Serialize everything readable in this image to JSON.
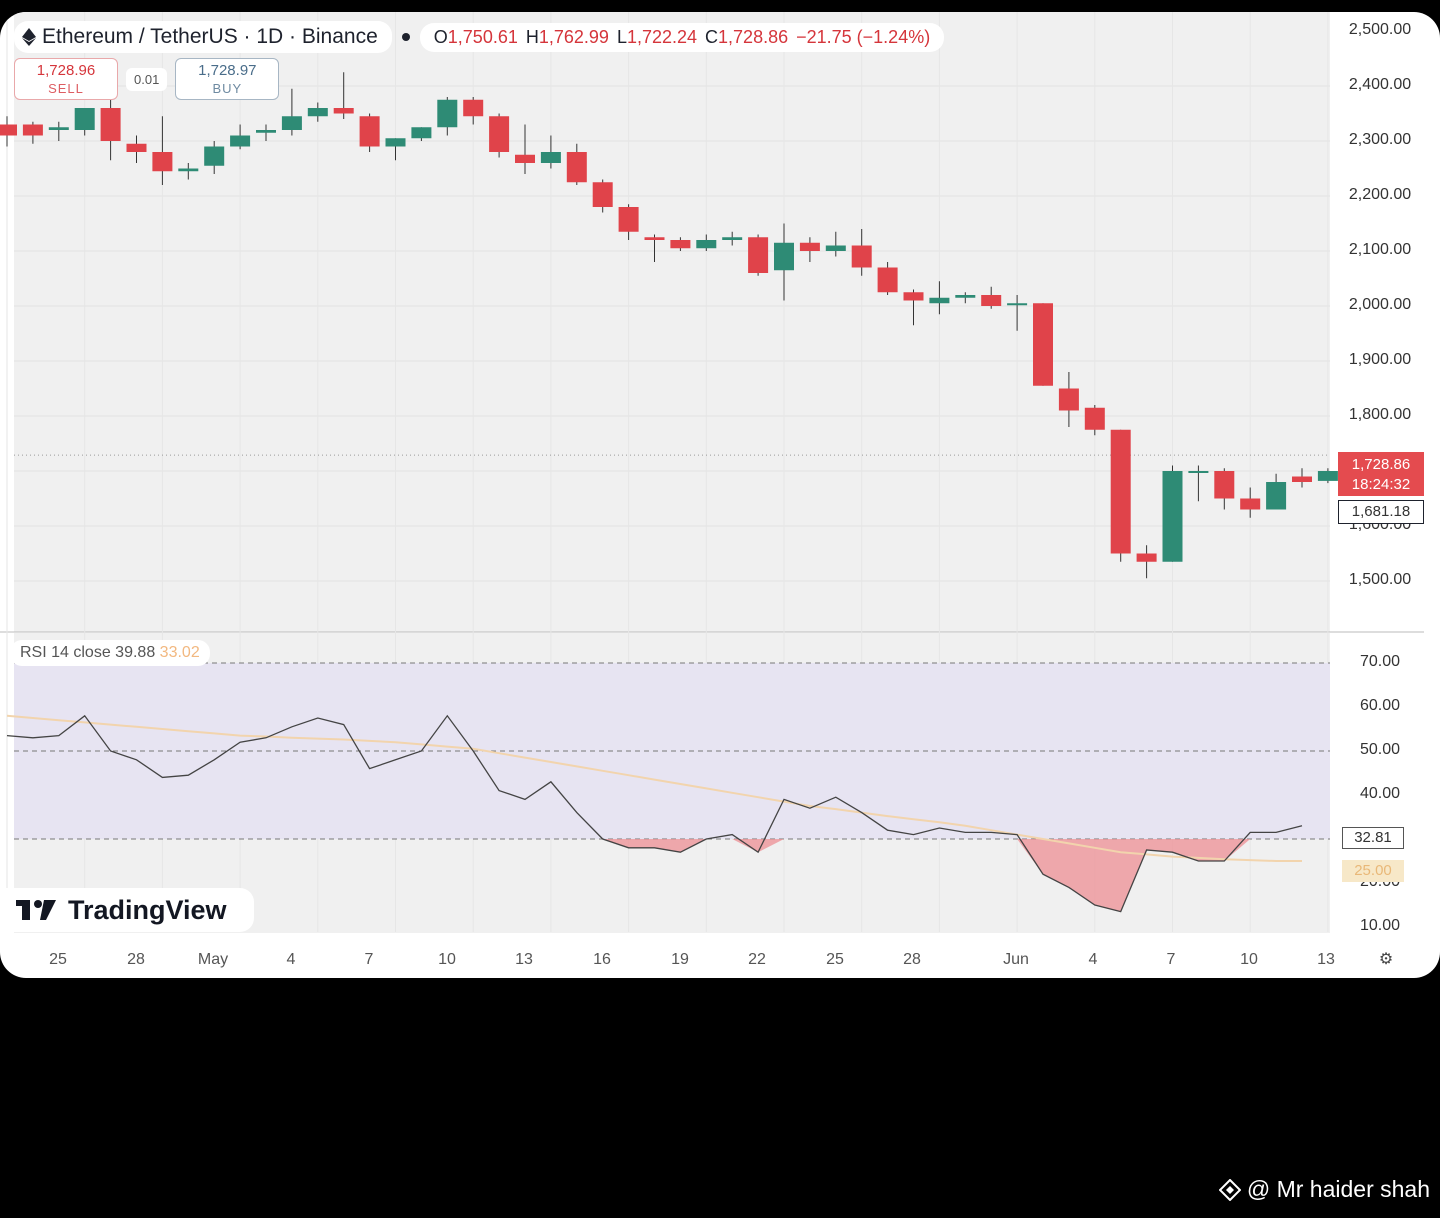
{
  "header": {
    "symbol_title": "Ethereum / TetherUS · 1D · Binance",
    "ohlc": {
      "o_label": "O",
      "o_value": "1,750.61",
      "h_label": "H",
      "h_value": "1,762.99",
      "l_label": "L",
      "l_value": "1,722.24",
      "c_label": "C",
      "c_value": "1,728.86",
      "change": "−21.75 (−1.24%)"
    }
  },
  "trade": {
    "sell_price": "1,728.96",
    "sell_label": "SELL",
    "spread": "0.01",
    "buy_price": "1,728.97",
    "buy_label": "BUY"
  },
  "price_scale": {
    "top_partial": "2,500.00",
    "labels": [
      "2,400.00",
      "2,300.00",
      "2,200.00",
      "2,100.00",
      "2,000.00",
      "1,900.00",
      "1,800.00",
      "1,600.00",
      "1,500.00"
    ],
    "current_price": "1,728.86",
    "countdown": "18:24:32",
    "ref_price": "1,681.18"
  },
  "rsi": {
    "legend_name": "RSI 14 close",
    "legend_value": "39.88",
    "legend_ma_value": "33.02",
    "scale": [
      "70.00",
      "60.00",
      "50.00",
      "40.00",
      "30.00",
      "20.00",
      "10.00"
    ],
    "current": "32.81",
    "ma_current": "25.00"
  },
  "time_axis": [
    "25",
    "28",
    "May",
    "4",
    "7",
    "10",
    "13",
    "16",
    "19",
    "22",
    "25",
    "28",
    "Jun",
    "4",
    "7",
    "10",
    "13"
  ],
  "branding": {
    "logo_text": "TradingView",
    "watermark": "@ Mr haider shah",
    "settings_glyph": "⚙"
  },
  "colors": {
    "up": "#2e8b75",
    "down": "#e0434a",
    "rsi_line": "#444444",
    "rsi_ma": "#f2d4ad",
    "rsi_band": "#e7e4f2",
    "oversold_fill": "#ee8f94"
  },
  "chart_data": {
    "type": "candlestick",
    "title": "Ethereum / TetherUS · 1D · Binance",
    "ylim": [
      1450,
      2500
    ],
    "candles": [
      {
        "o": 2330,
        "h": 2345,
        "l": 2290,
        "c": 2310
      },
      {
        "o": 2330,
        "h": 2335,
        "l": 2295,
        "c": 2310
      },
      {
        "o": 2320,
        "h": 2335,
        "l": 2300,
        "c": 2325
      },
      {
        "o": 2320,
        "h": 2360,
        "l": 2310,
        "c": 2360
      },
      {
        "o": 2360,
        "h": 2380,
        "l": 2265,
        "c": 2300
      },
      {
        "o": 2295,
        "h": 2310,
        "l": 2260,
        "c": 2280
      },
      {
        "o": 2280,
        "h": 2345,
        "l": 2220,
        "c": 2245
      },
      {
        "o": 2245,
        "h": 2260,
        "l": 2230,
        "c": 2250
      },
      {
        "o": 2255,
        "h": 2300,
        "l": 2240,
        "c": 2290
      },
      {
        "o": 2290,
        "h": 2330,
        "l": 2285,
        "c": 2310
      },
      {
        "o": 2315,
        "h": 2330,
        "l": 2300,
        "c": 2320
      },
      {
        "o": 2320,
        "h": 2395,
        "l": 2310,
        "c": 2345
      },
      {
        "o": 2345,
        "h": 2370,
        "l": 2335,
        "c": 2360
      },
      {
        "o": 2360,
        "h": 2425,
        "l": 2340,
        "c": 2350
      },
      {
        "o": 2345,
        "h": 2350,
        "l": 2280,
        "c": 2290
      },
      {
        "o": 2290,
        "h": 2305,
        "l": 2265,
        "c": 2305
      },
      {
        "o": 2305,
        "h": 2325,
        "l": 2300,
        "c": 2325
      },
      {
        "o": 2325,
        "h": 2380,
        "l": 2310,
        "c": 2375
      },
      {
        "o": 2375,
        "h": 2380,
        "l": 2330,
        "c": 2345
      },
      {
        "o": 2345,
        "h": 2350,
        "l": 2270,
        "c": 2280
      },
      {
        "o": 2275,
        "h": 2330,
        "l": 2240,
        "c": 2260
      },
      {
        "o": 2260,
        "h": 2310,
        "l": 2250,
        "c": 2280
      },
      {
        "o": 2280,
        "h": 2295,
        "l": 2220,
        "c": 2225
      },
      {
        "o": 2225,
        "h": 2230,
        "l": 2170,
        "c": 2180
      },
      {
        "o": 2180,
        "h": 2185,
        "l": 2120,
        "c": 2135
      },
      {
        "o": 2125,
        "h": 2130,
        "l": 2080,
        "c": 2120
      },
      {
        "o": 2120,
        "h": 2125,
        "l": 2100,
        "c": 2105
      },
      {
        "o": 2105,
        "h": 2130,
        "l": 2100,
        "c": 2120
      },
      {
        "o": 2120,
        "h": 2135,
        "l": 2110,
        "c": 2125
      },
      {
        "o": 2125,
        "h": 2130,
        "l": 2055,
        "c": 2060
      },
      {
        "o": 2065,
        "h": 2150,
        "l": 2010,
        "c": 2115
      },
      {
        "o": 2115,
        "h": 2125,
        "l": 2080,
        "c": 2100
      },
      {
        "o": 2100,
        "h": 2135,
        "l": 2090,
        "c": 2110
      },
      {
        "o": 2110,
        "h": 2140,
        "l": 2055,
        "c": 2070
      },
      {
        "o": 2070,
        "h": 2080,
        "l": 2020,
        "c": 2025
      },
      {
        "o": 2025,
        "h": 2030,
        "l": 1965,
        "c": 2010
      },
      {
        "o": 2005,
        "h": 2045,
        "l": 1985,
        "c": 2015
      },
      {
        "o": 2015,
        "h": 2025,
        "l": 2005,
        "c": 2020
      },
      {
        "o": 2020,
        "h": 2035,
        "l": 1995,
        "c": 2000
      },
      {
        "o": 2005,
        "h": 2020,
        "l": 1955,
        "c": 2005
      },
      {
        "o": 2005,
        "h": 2005,
        "l": 1855,
        "c": 1855
      },
      {
        "o": 1850,
        "h": 1880,
        "l": 1780,
        "c": 1810
      },
      {
        "o": 1815,
        "h": 1820,
        "l": 1765,
        "c": 1775
      },
      {
        "o": 1775,
        "h": 1775,
        "l": 1535,
        "c": 1550
      },
      {
        "o": 1550,
        "h": 1565,
        "l": 1505,
        "c": 1535
      },
      {
        "o": 1535,
        "h": 1710,
        "l": 1535,
        "c": 1700
      },
      {
        "o": 1700,
        "h": 1710,
        "l": 1645,
        "c": 1700
      },
      {
        "o": 1700,
        "h": 1705,
        "l": 1630,
        "c": 1650
      },
      {
        "o": 1650,
        "h": 1670,
        "l": 1615,
        "c": 1630
      },
      {
        "o": 1630,
        "h": 1695,
        "l": 1630,
        "c": 1680
      },
      {
        "o": 1690,
        "h": 1705,
        "l": 1670,
        "c": 1680
      },
      {
        "o": 1682,
        "h": 1705,
        "l": 1678,
        "c": 1700
      }
    ],
    "rsi": {
      "ylim": [
        0,
        80
      ],
      "series": [
        {
          "name": "RSI 14 close",
          "values": [
            53.5,
            53,
            53.5,
            58,
            50,
            48,
            44,
            44.5,
            48,
            52,
            53,
            55.5,
            57.5,
            56,
            46,
            48,
            50,
            58,
            50,
            41,
            39,
            43,
            36,
            30,
            28,
            28,
            27,
            30,
            31,
            27,
            39,
            37,
            39.5,
            36,
            32,
            31,
            32.5,
            31.5,
            31.5,
            31,
            22,
            19,
            15,
            13.5,
            27.5,
            27,
            25,
            25,
            31.5,
            31.5,
            33
          ]
        },
        {
          "name": "RSI MA",
          "values": [
            58,
            57.5,
            57,
            56.5,
            56,
            55.5,
            55,
            54.5,
            54,
            53.5,
            53.3,
            53,
            52.8,
            52.6,
            52.3,
            52,
            51.5,
            51,
            50.5,
            49.5,
            48.5,
            47.5,
            46.5,
            45.5,
            44.5,
            43.5,
            42.5,
            41.5,
            40.5,
            39.5,
            38.5,
            37.5,
            36.8,
            36,
            35.2,
            34.5,
            33.8,
            33,
            32,
            31,
            30,
            29,
            28,
            27,
            26.5,
            26,
            25.7,
            25.4,
            25.2,
            25,
            25
          ]
        }
      ],
      "levels": [
        70,
        50,
        30
      ]
    }
  }
}
